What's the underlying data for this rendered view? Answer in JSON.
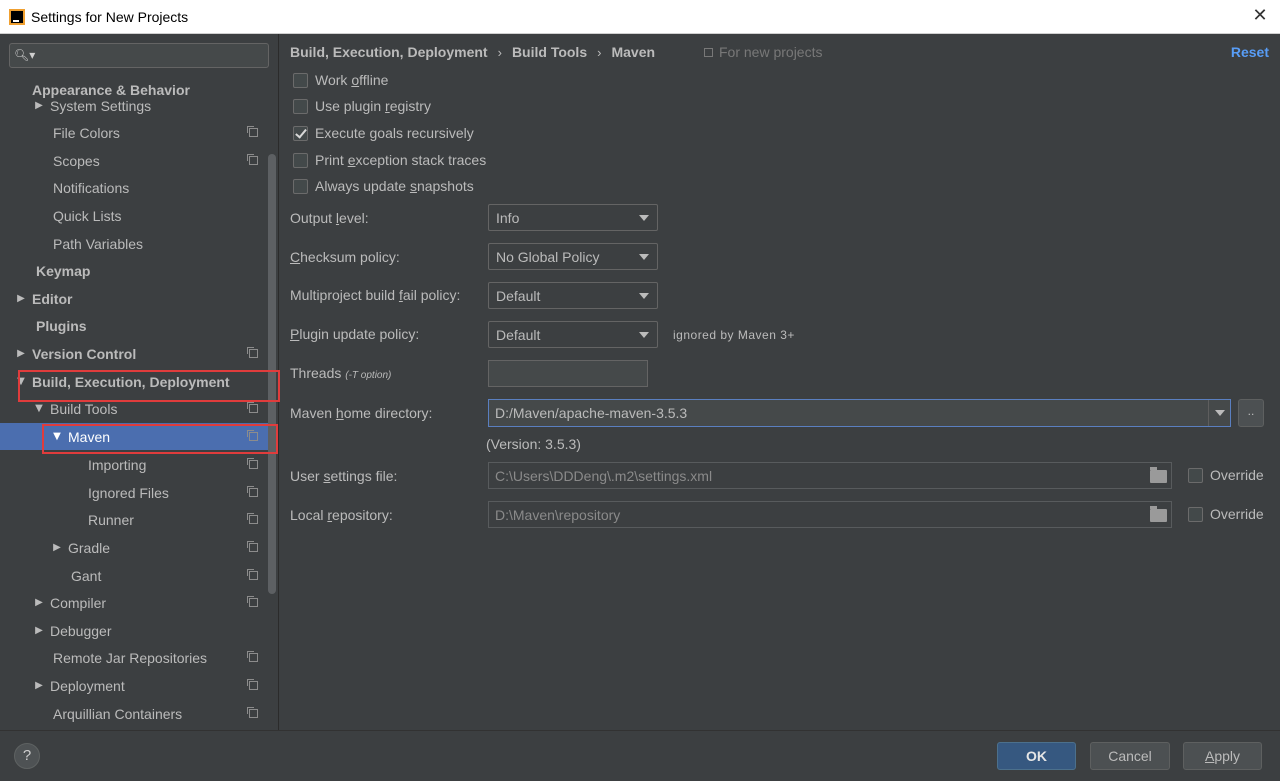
{
  "window": {
    "title": "Settings for New Projects"
  },
  "sidebar": {
    "search_placeholder": "",
    "items": [
      {
        "label": "Appearance & Behavior"
      },
      {
        "label": "System Settings"
      },
      {
        "label": "File Colors"
      },
      {
        "label": "Scopes"
      },
      {
        "label": "Notifications"
      },
      {
        "label": "Quick Lists"
      },
      {
        "label": "Path Variables"
      },
      {
        "label": "Keymap"
      },
      {
        "label": "Editor"
      },
      {
        "label": "Plugins"
      },
      {
        "label": "Version Control"
      },
      {
        "label": "Build, Execution, Deployment"
      },
      {
        "label": "Build Tools"
      },
      {
        "label": "Maven"
      },
      {
        "label": "Importing"
      },
      {
        "label": "Ignored Files"
      },
      {
        "label": "Runner"
      },
      {
        "label": "Gradle"
      },
      {
        "label": "Gant"
      },
      {
        "label": "Compiler"
      },
      {
        "label": "Debugger"
      },
      {
        "label": "Remote Jar Repositories"
      },
      {
        "label": "Deployment"
      },
      {
        "label": "Arquillian Containers"
      }
    ]
  },
  "header": {
    "breadcrumb": [
      "Build, Execution, Deployment",
      "Build Tools",
      "Maven"
    ],
    "separator": "›",
    "scope_note": "For new projects",
    "reset": "Reset"
  },
  "checkboxes": [
    {
      "pre": "Work ",
      "u": "o",
      "post": "ffline",
      "checked": false
    },
    {
      "pre": "Use plugin ",
      "u": "r",
      "post": "egistry",
      "checked": false
    },
    {
      "pre": "Execute ",
      "u": "g",
      "post": "oals recursively",
      "checked": true
    },
    {
      "pre": "Print ",
      "u": "e",
      "post": "xception stack traces",
      "checked": false
    },
    {
      "pre": "Always update ",
      "u": "s",
      "post": "napshots",
      "checked": false
    }
  ],
  "form": {
    "output_level": {
      "pre": "Output ",
      "u": "l",
      "post": "evel:",
      "value": "Info"
    },
    "checksum_policy": {
      "pre": "",
      "u": "C",
      "post": "hecksum policy:",
      "value": "No Global Policy"
    },
    "fail_policy": {
      "pre": "Multiproject build ",
      "u": "f",
      "post": "ail policy:",
      "value": "Default"
    },
    "plugin_update": {
      "pre": "",
      "u": "P",
      "post": "lugin update policy:",
      "value": "Default",
      "hint": "ignored by Maven 3+"
    },
    "threads": {
      "label": "Threads",
      "small": "(-T option)",
      "value": ""
    },
    "maven_home": {
      "pre": "Maven ",
      "u": "h",
      "post": "ome directory:",
      "value": "D:/Maven/apache-maven-3.5.3",
      "browse": "..",
      "version": "(Version: 3.5.3)"
    },
    "user_settings": {
      "pre": "User ",
      "u": "s",
      "post": "ettings file:",
      "value": "C:\\Users\\DDDeng\\.m2\\settings.xml",
      "override": "Override"
    },
    "local_repo": {
      "pre": "Local ",
      "u": "r",
      "post": "epository:",
      "value": "D:\\Maven\\repository",
      "override": "Override"
    }
  },
  "footer": {
    "help": "?",
    "ok": "OK",
    "cancel": "Cancel",
    "apply_pre": "",
    "apply_u": "A",
    "apply_post": "pply"
  },
  "colors": {
    "background": "#3c3f41",
    "selection": "#4b6eaf",
    "link": "#589df6",
    "highlight_box": "#e03c3c"
  }
}
